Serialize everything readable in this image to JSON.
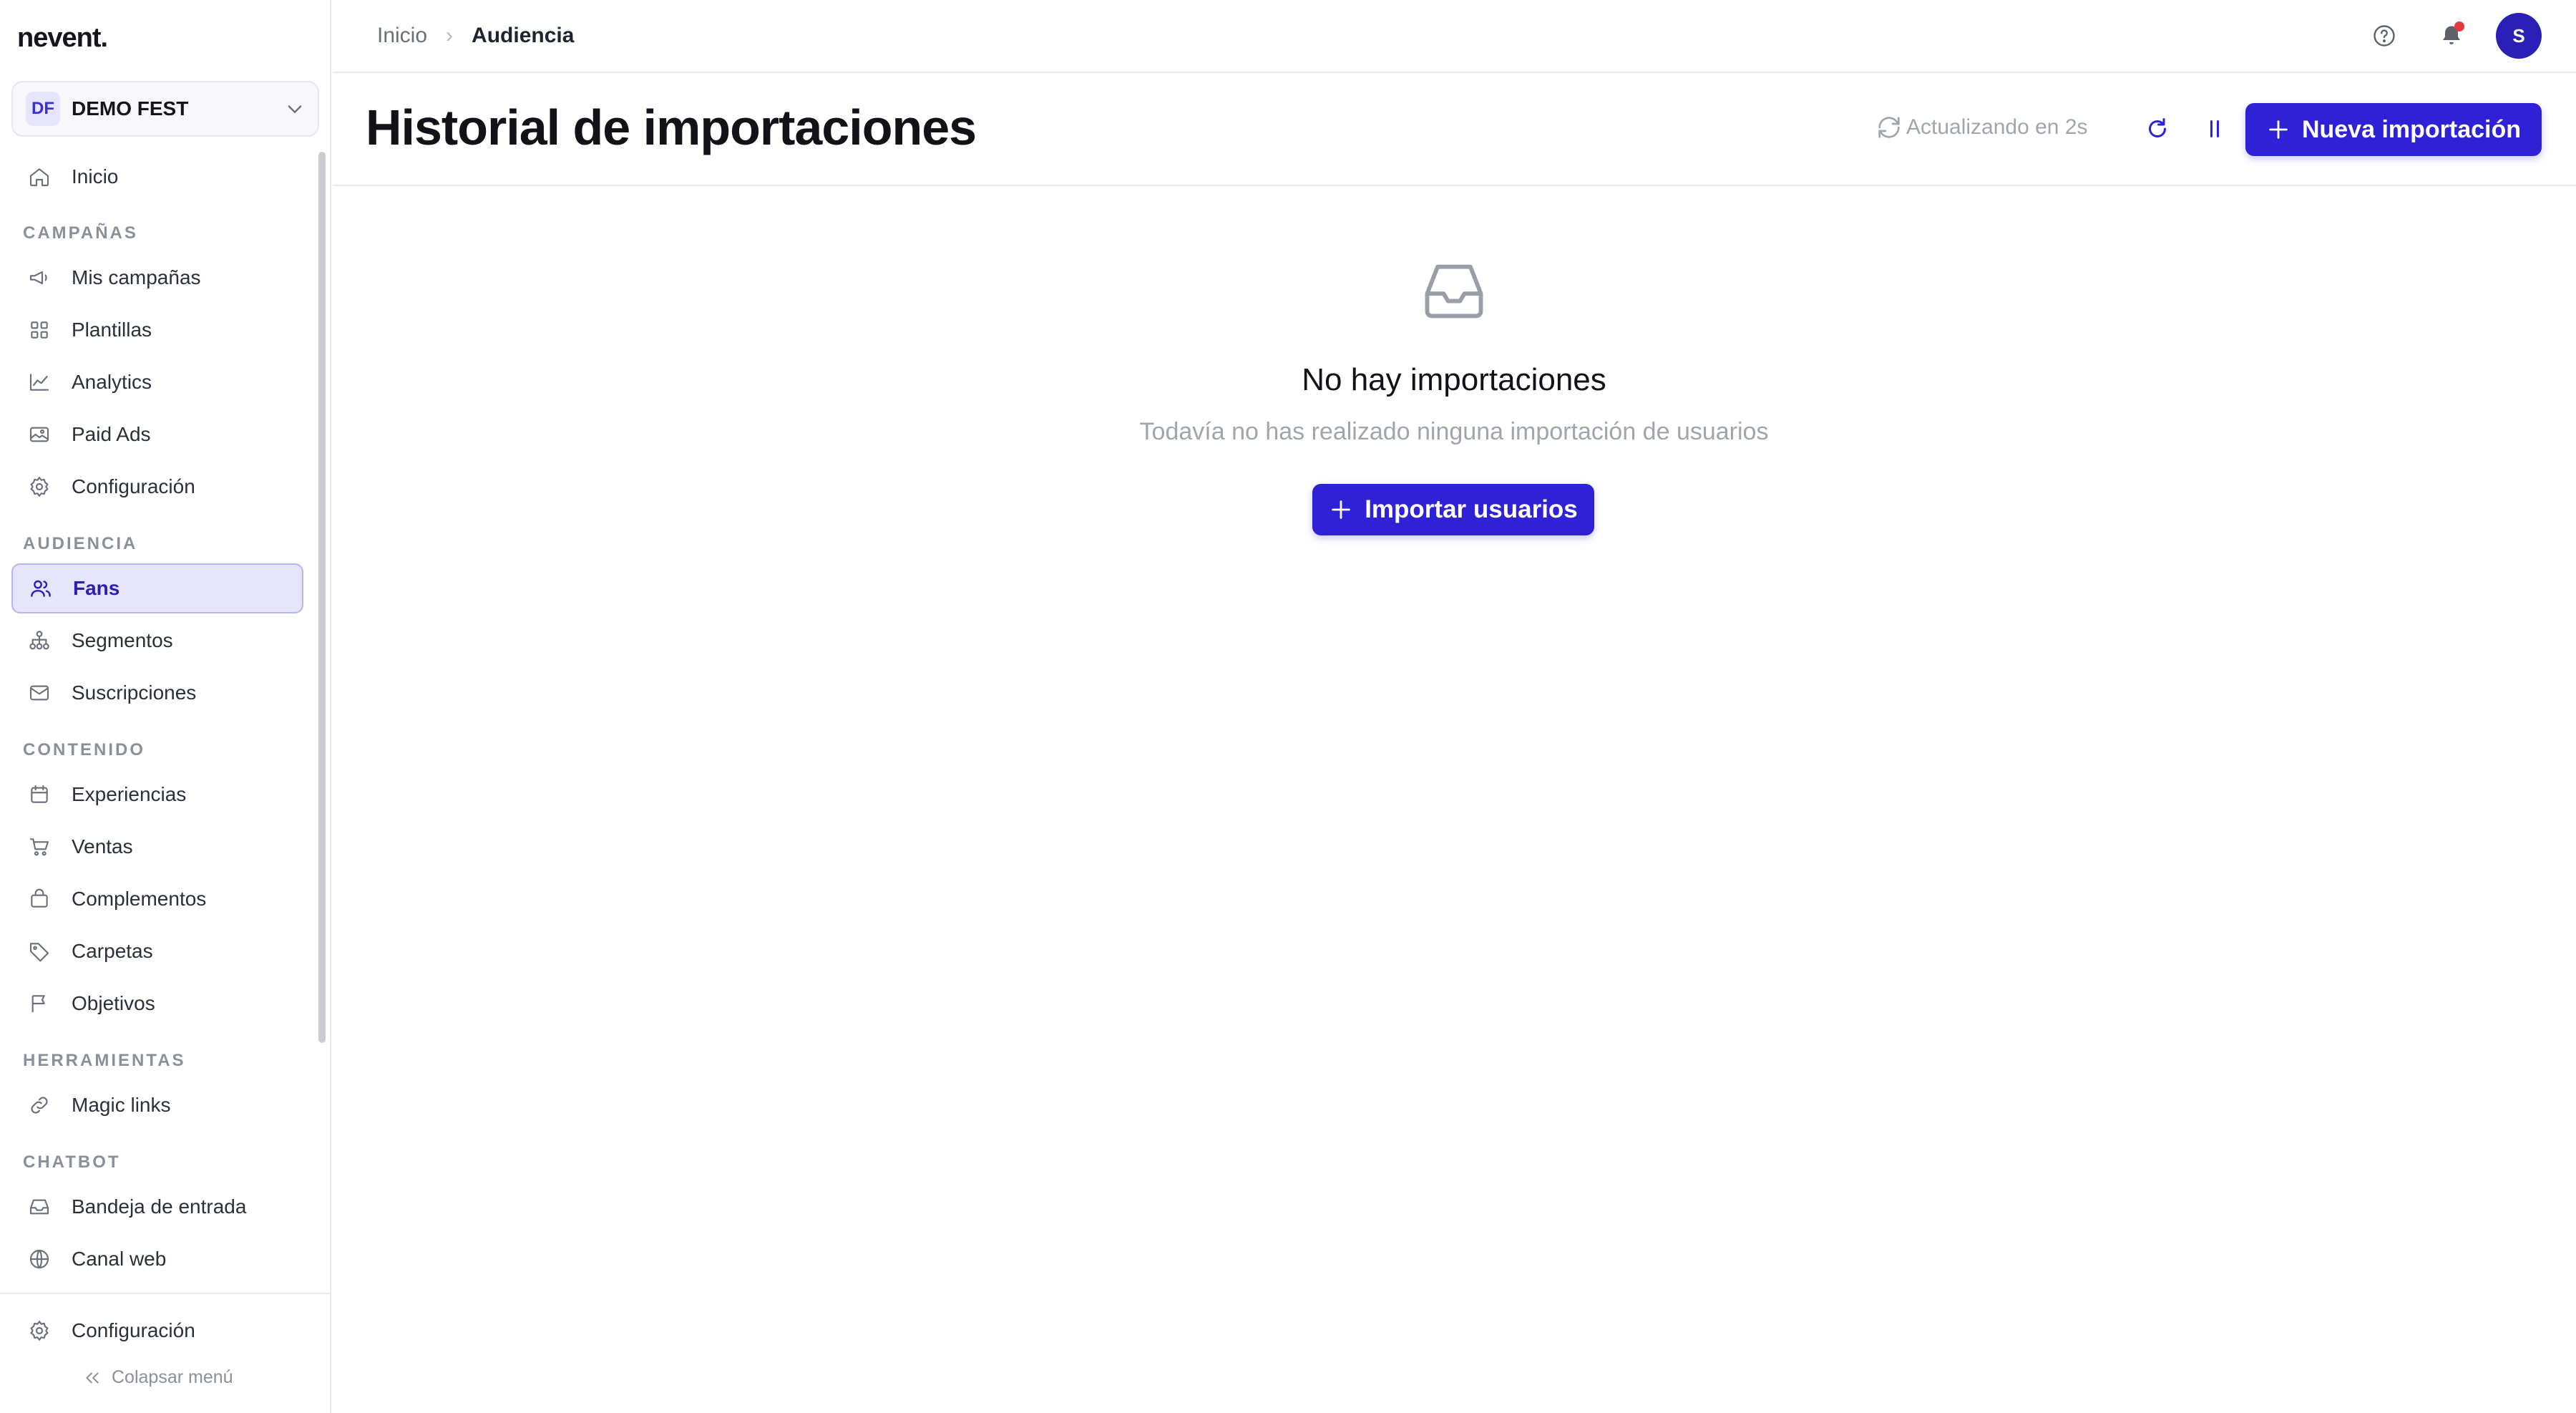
{
  "app": {
    "logo": "nevent."
  },
  "workspace": {
    "badge": "DF",
    "name": "DEMO FEST"
  },
  "sidebar": {
    "items": [
      {
        "label": "Inicio"
      }
    ],
    "sections": [
      {
        "title": "CAMPAÑAS",
        "items": [
          {
            "label": "Mis campañas"
          },
          {
            "label": "Plantillas"
          },
          {
            "label": "Analytics"
          },
          {
            "label": "Paid Ads"
          },
          {
            "label": "Configuración"
          }
        ]
      },
      {
        "title": "AUDIENCIA",
        "items": [
          {
            "label": "Fans",
            "active": true
          },
          {
            "label": "Segmentos"
          },
          {
            "label": "Suscripciones"
          }
        ]
      },
      {
        "title": "CONTENIDO",
        "items": [
          {
            "label": "Experiencias"
          },
          {
            "label": "Ventas"
          },
          {
            "label": "Complementos"
          },
          {
            "label": "Carpetas"
          },
          {
            "label": "Objetivos"
          }
        ]
      },
      {
        "title": "HERRAMIENTAS",
        "items": [
          {
            "label": "Magic links"
          }
        ]
      },
      {
        "title": "CHATBOT",
        "items": [
          {
            "label": "Bandeja de entrada"
          },
          {
            "label": "Canal web"
          }
        ]
      }
    ],
    "footer": {
      "settings_label": "Configuración",
      "collapse_label": "Colapsar menú"
    }
  },
  "breadcrumb": {
    "home": "Inicio",
    "current": "Audiencia"
  },
  "user": {
    "avatar_initial": "S"
  },
  "page": {
    "title": "Historial de importaciones",
    "refresh_status": "Actualizando en 2s",
    "new_import_label": "Nueva importación"
  },
  "empty_state": {
    "title": "No hay importaciones",
    "subtitle": "Todavía no has realizado ninguna importación de usuarios",
    "action_label": "Importar usuarios"
  },
  "colors": {
    "accent": "#2f22d6",
    "active_bg": "#e6e5fb",
    "notification": "#e23a3a"
  }
}
